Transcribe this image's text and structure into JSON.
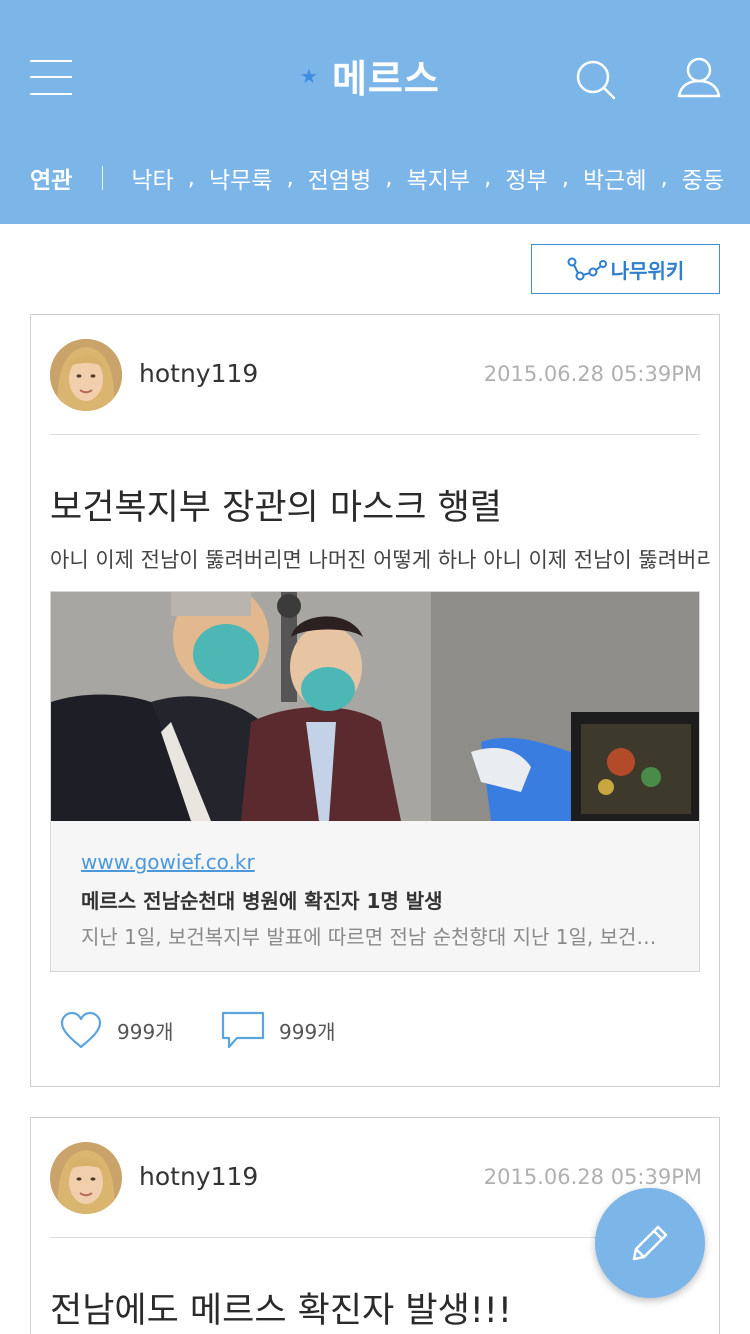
{
  "header": {
    "title": "메르스",
    "related_label": "연관",
    "tags": [
      "낙타",
      "낙무룩",
      "전염병",
      "복지부",
      "정부",
      "박근혜",
      "중동"
    ],
    "comma": ","
  },
  "wiki_button": {
    "label": "나무위키"
  },
  "posts": [
    {
      "username": "hotny119",
      "date": "2015.06.28  05:39PM",
      "title": "보건복지부 장관의 마스크 행렬",
      "body": "아니 이제 전남이 뚫려버리면 나머진 어떻게 하나 아니 이제 전남이 뚫려버리면",
      "link": {
        "url": "www.gowief.co.kr ",
        "title": "메르스 전남순천대 병원에 확진자 1명 발생",
        "description": "지난 1일, 보건복지부 발표에 따르면 전남 순천향대 지난 1일, 보건복 ..."
      },
      "likes": "999개",
      "comments": "999개"
    },
    {
      "username": "hotny119",
      "date": "2015.06.28  05:39PM",
      "title": "전남에도 메르스 확진자 발생!!!"
    }
  ],
  "colors": {
    "header_bg": "#7cb5e8",
    "accent": "#3d8ee0",
    "link": "#4b98dc"
  },
  "icons": [
    "menu-icon",
    "star-icon",
    "search-icon",
    "user-icon",
    "namuwiki-logo-icon",
    "heart-icon",
    "comment-icon",
    "pencil-icon"
  ]
}
